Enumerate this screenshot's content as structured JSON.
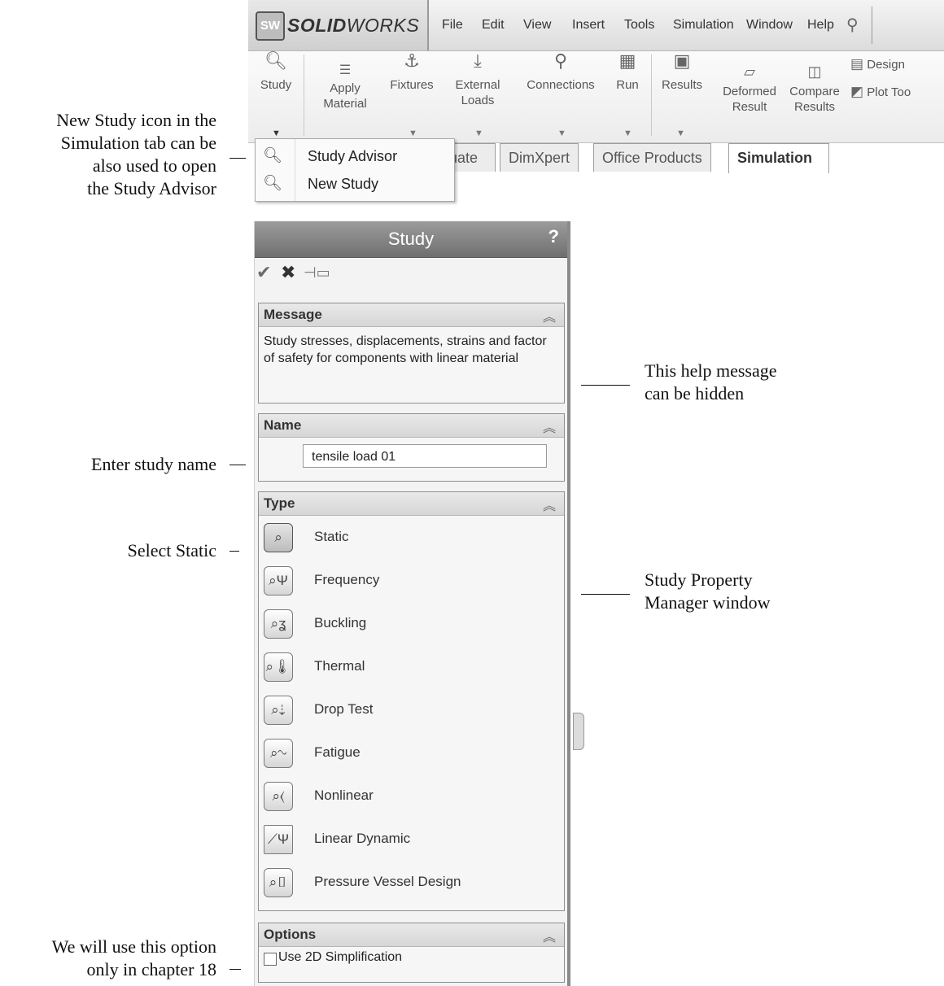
{
  "app": {
    "logo_mark": "SW",
    "logo_solid": "SOLID",
    "logo_works": "WORKS",
    "menus": [
      "File",
      "Edit",
      "View",
      "Insert",
      "Tools",
      "Simulation",
      "Window",
      "Help"
    ],
    "ribbon": {
      "study": "Study",
      "apply_material": [
        "Apply",
        "Material"
      ],
      "fixtures": "Fixtures",
      "external_loads": [
        "External",
        "Loads"
      ],
      "connections": "Connections",
      "run": "Run",
      "results": "Results",
      "deformed_result": [
        "Deformed",
        "Result"
      ],
      "compare_results": [
        "Compare",
        "Results"
      ],
      "design": "Design",
      "plot_tools": "Plot Too"
    },
    "tabs": [
      "luate",
      "DimXpert",
      "Office Products",
      "Simulation"
    ],
    "active_tab": "Simulation",
    "study_dropdown": [
      "Study Advisor",
      "New Study"
    ]
  },
  "property_manager": {
    "title": "Study",
    "help": "?",
    "message": {
      "title": "Message",
      "text": "Study stresses, displacements, strains and factor of safety  for components with linear material"
    },
    "name": {
      "title": "Name",
      "value": "tensile load 01"
    },
    "type": {
      "title": "Type",
      "options": [
        "Static",
        "Frequency",
        "Buckling",
        "Thermal",
        "Drop Test",
        "Fatigue",
        "Nonlinear",
        "Linear Dynamic",
        "Pressure Vessel Design"
      ],
      "selected": "Static"
    },
    "options": {
      "title": "Options",
      "checkbox_label": "Use 2D Simplification",
      "checked": false
    }
  },
  "callouts": {
    "new_study": [
      "New Study icon in the",
      "Simulation tab can be",
      "also  used to open",
      "the Study Advisor"
    ],
    "help_message": [
      "This help message",
      "can be hidden"
    ],
    "study_name": "Enter study name",
    "select_static": "Select Static",
    "pm_window": [
      "Study Property",
      "Manager window"
    ],
    "option_note": [
      "We will use  this option",
      "only in chapter 18"
    ]
  }
}
